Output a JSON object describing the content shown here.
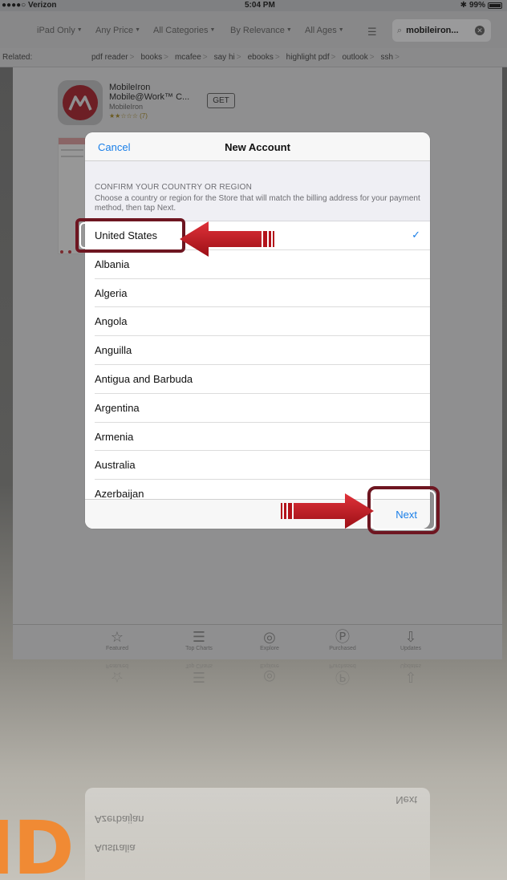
{
  "status_bar": {
    "carrier": "●●●●○ Verizon",
    "time": "5:04 PM",
    "battery": "99%"
  },
  "filters": {
    "device": "iPad Only",
    "price": "Any Price",
    "category": "All Categories",
    "sort": "By Relevance",
    "ages": "All Ages",
    "search_value": "mobileiron..."
  },
  "related": {
    "label": "Related:",
    "items": [
      "pdf reader",
      "books",
      "mcafee",
      "say hi",
      "ebooks",
      "highlight pdf",
      "outlook",
      "ssh"
    ]
  },
  "app": {
    "developer_line": "MobileIron",
    "name": "Mobile@Work™ C...",
    "publisher": "MobileIron",
    "rating_count": "(7)",
    "get_label": "GET"
  },
  "modal": {
    "cancel_label": "Cancel",
    "title": "New Account",
    "section_header": "CONFIRM YOUR COUNTRY OR REGION",
    "section_description": "Choose a country or region for the Store that will match the billing address for your payment method, then tap Next.",
    "countries": [
      {
        "name": "United States",
        "selected": true
      },
      {
        "name": "Albania",
        "selected": false
      },
      {
        "name": "Algeria",
        "selected": false
      },
      {
        "name": "Angola",
        "selected": false
      },
      {
        "name": "Anguilla",
        "selected": false
      },
      {
        "name": "Antigua and Barbuda",
        "selected": false
      },
      {
        "name": "Argentina",
        "selected": false
      },
      {
        "name": "Armenia",
        "selected": false
      },
      {
        "name": "Australia",
        "selected": false
      },
      {
        "name": "Azerbaijan",
        "selected": false
      }
    ],
    "next_label": "Next"
  },
  "tabbar": {
    "items": [
      {
        "label": "Featured",
        "icon": "star-icon"
      },
      {
        "label": "Top Charts",
        "icon": "list-icon"
      },
      {
        "label": "Explore",
        "icon": "compass-icon"
      },
      {
        "label": "Purchased",
        "icon": "purchased-icon"
      },
      {
        "label": "Updates",
        "icon": "download-icon"
      }
    ]
  },
  "watermark": {
    "text": "ID"
  },
  "colors": {
    "accent_blue": "#1a7fe8",
    "highlight_maroon": "#6e1621",
    "arrow_red": "#c0141d",
    "watermark_orange": "#f08a34"
  }
}
